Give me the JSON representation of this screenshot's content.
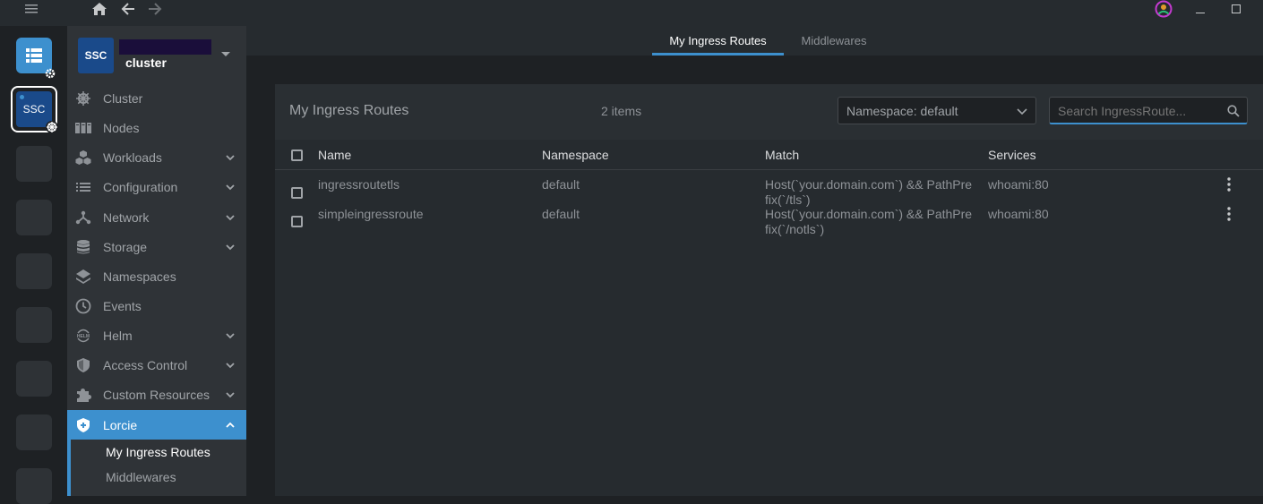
{
  "topbar": {
    "menu_icon": "hamburger-menu-icon",
    "home_icon": "home-icon",
    "back_icon": "arrow-left-icon",
    "forward_icon": "arrow-right-icon",
    "account_icon": "user-avatar-icon",
    "minimize_icon": "minimize-icon",
    "maximize_icon": "maximize-icon"
  },
  "hotbar": {
    "items": [
      {
        "icon": "catalog-icon",
        "badge_icon": "gear-icon"
      },
      {
        "label": "SSC",
        "badge_icon": "kubernetes-helm-icon"
      }
    ]
  },
  "cluster": {
    "avatar": "SSC",
    "name": "cluster"
  },
  "sidebar": {
    "items": [
      {
        "label": "Cluster",
        "icon": "helm-wheel-icon"
      },
      {
        "label": "Nodes",
        "icon": "server-rack-icon"
      },
      {
        "label": "Workloads",
        "icon": "cubes-icon"
      },
      {
        "label": "Configuration",
        "icon": "list-icon"
      },
      {
        "label": "Network",
        "icon": "network-tree-icon"
      },
      {
        "label": "Storage",
        "icon": "database-icon"
      },
      {
        "label": "Namespaces",
        "icon": "layers-icon"
      },
      {
        "label": "Events",
        "icon": "clock-icon"
      },
      {
        "label": "Helm",
        "icon": "helm-logo-icon"
      },
      {
        "label": "Access Control",
        "icon": "shield-icon"
      },
      {
        "label": "Custom Resources",
        "icon": "puzzle-icon"
      },
      {
        "label": "Lorcie",
        "icon": "shield-plus-icon"
      }
    ],
    "sub_items": [
      {
        "label": "My Ingress Routes"
      },
      {
        "label": "Middlewares"
      }
    ]
  },
  "tabs": [
    {
      "label": "My Ingress Routes",
      "active": true
    },
    {
      "label": "Middlewares",
      "active": false
    }
  ],
  "panel": {
    "title": "My Ingress Routes",
    "count": "2 items",
    "namespace_select": "Namespace: default",
    "search_placeholder": "Search IngressRoute..."
  },
  "table": {
    "columns": [
      "Name",
      "Namespace",
      "Match",
      "Services"
    ],
    "rows": [
      {
        "name": "ingressroutetls",
        "namespace": "default",
        "match_line1": "Host(`your.domain.com`) && PathPre",
        "match_line2": "fix(`/tls`)",
        "services": "whoami:80"
      },
      {
        "name": "simpleingressroute",
        "namespace": "default",
        "match_line1": "Host(`your.domain.com`) && PathPre",
        "match_line2": "fix(`/notls`)",
        "services": "whoami:80"
      }
    ]
  },
  "colors": {
    "accent": "#3d90ce",
    "active_nav": "#3d90ce",
    "cluster_avatar": "#1a4a8a"
  }
}
